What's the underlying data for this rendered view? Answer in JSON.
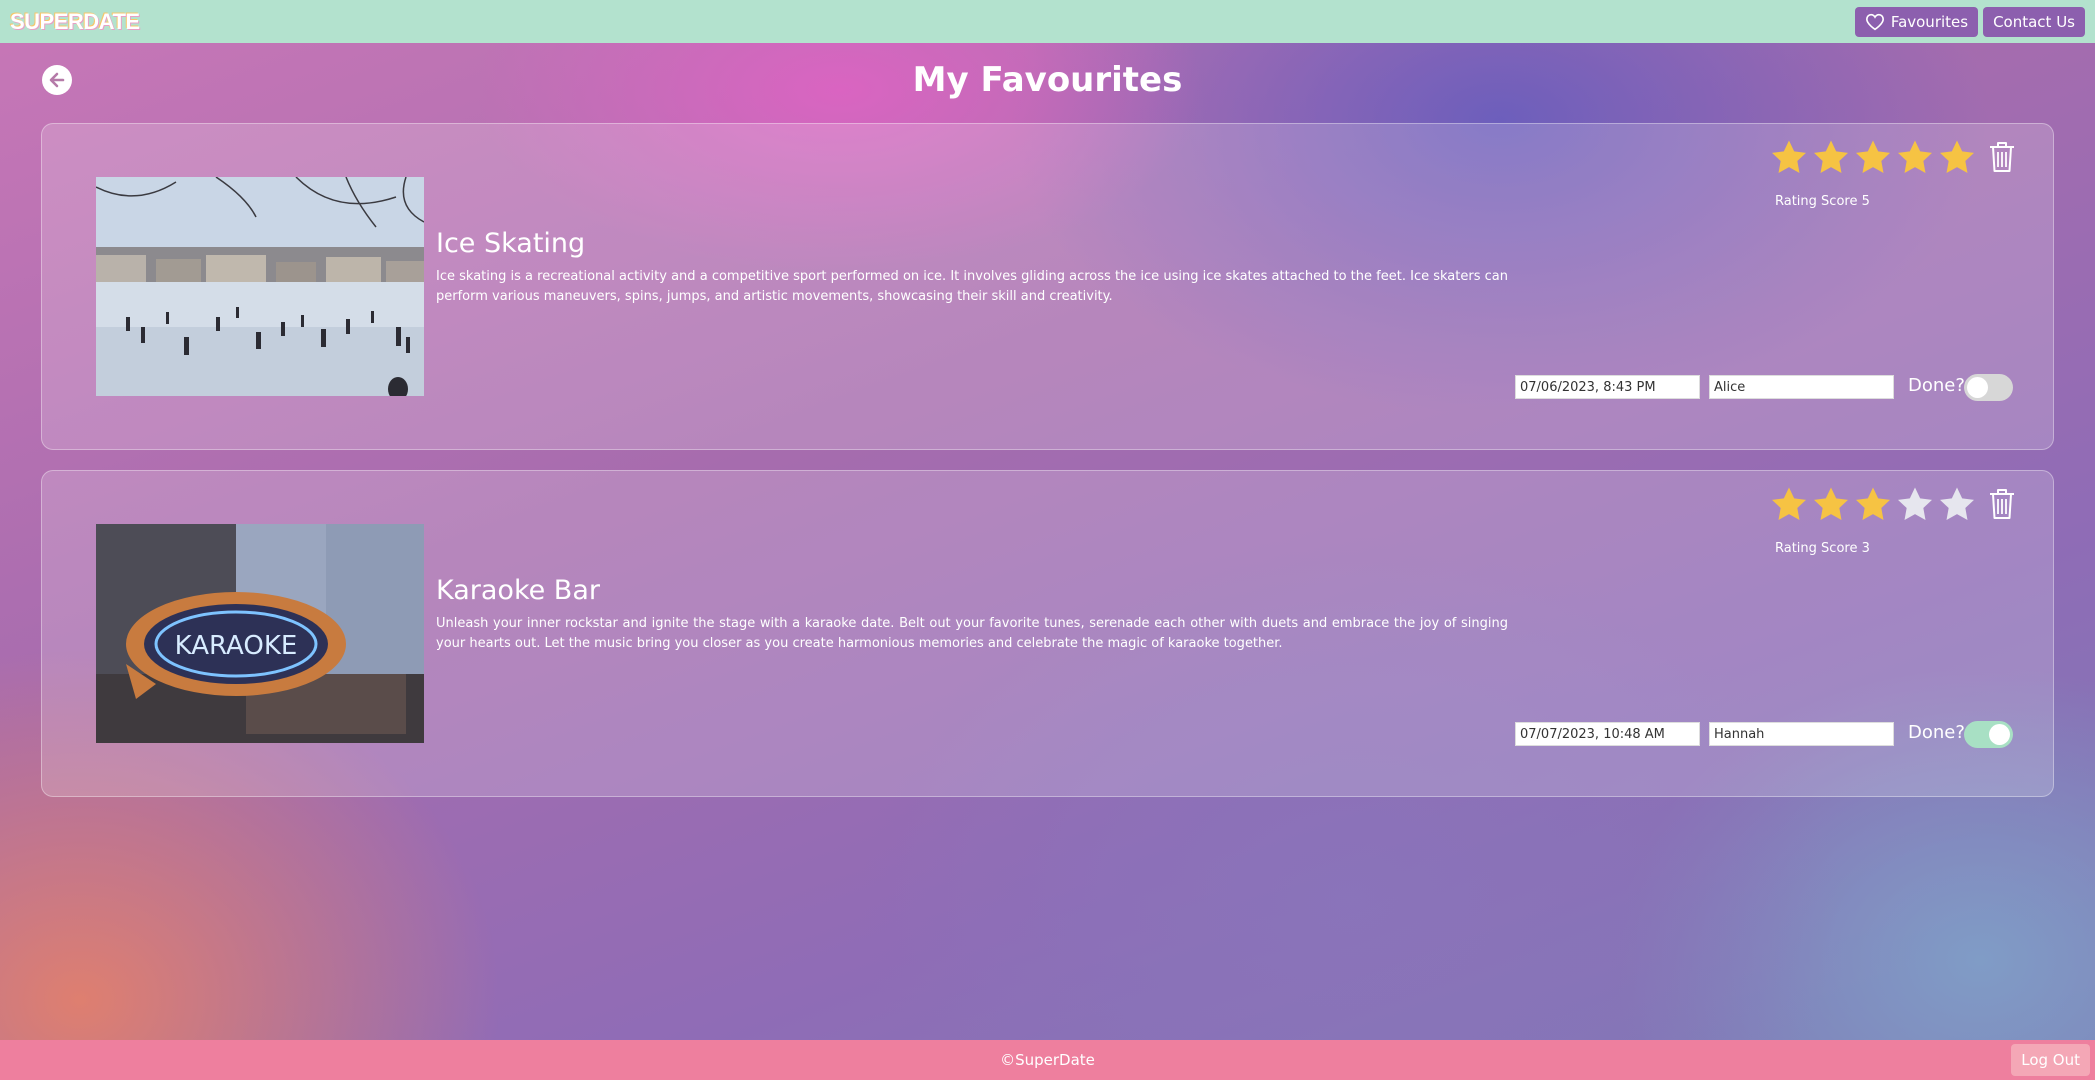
{
  "header": {
    "logo": "SUPERDATE",
    "favourites_label": "Favourites",
    "contact_label": "Contact Us"
  },
  "page": {
    "title": "My Favourites"
  },
  "cards": [
    {
      "title": "Ice Skating",
      "description": "Ice skating is a recreational activity and a competitive sport performed on ice. It involves gliding across the ice using ice skates attached to the feet. Ice skaters can perform various maneuvers, spins, jumps, and artistic movements, showcasing their skill and creativity.",
      "rating": 5,
      "rating_label": "Rating Score 5",
      "date": "07/06/2023, 8:43 PM",
      "partner": "Alice",
      "done_label": "Done?",
      "done": false
    },
    {
      "title": "Karaoke Bar",
      "description": "Unleash your inner rockstar and ignite the stage with a karaoke date. Belt out your favorite tunes, serenade each other with duets and embrace the joy of singing your hearts out. Let the music bring you closer as you create harmonious memories and celebrate the magic of karaoke together.",
      "rating": 3,
      "rating_label": "Rating Score 3",
      "date": "07/07/2023, 10:48 AM",
      "partner": "Hannah",
      "done_label": "Done?",
      "done": true
    }
  ],
  "footer": {
    "copyright": "©SuperDate",
    "logout_label": "Log Out"
  },
  "colors": {
    "header_bg": "#b3e2ce",
    "nav_button": "#8c5fae",
    "footer_bg": "#ee7f9e",
    "star_filled": "#f6c343",
    "star_empty": "#e6e6ee",
    "toggle_on": "#a8e0c4",
    "toggle_off": "#d7d7d7"
  },
  "icons": {
    "back": "arrow-left-icon",
    "favourites": "heart-icon",
    "delete": "trash-icon",
    "rating": "star-icon"
  }
}
